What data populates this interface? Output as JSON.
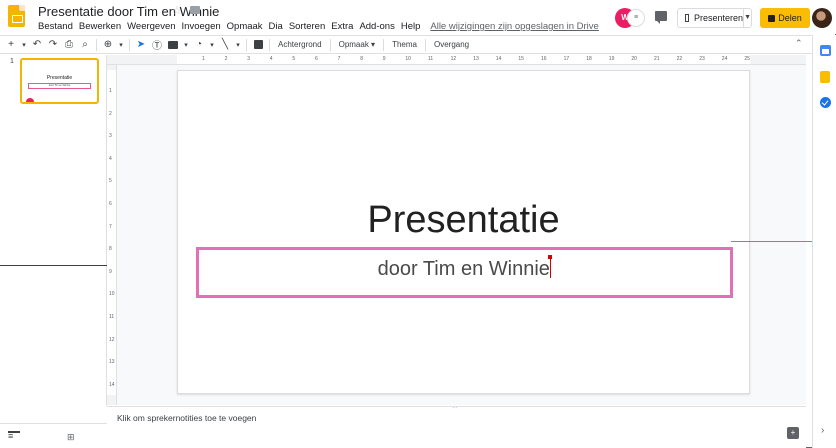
{
  "header": {
    "doc_title": "Presentatie door Tim en Winnie",
    "menu": [
      "Bestand",
      "Bewerken",
      "Weergeven",
      "Invoegen",
      "Opmaak",
      "Dia",
      "Sorteren",
      "Extra",
      "Add-ons",
      "Help"
    ],
    "save_status": "Alle wijzigingen zijn opgeslagen in Drive",
    "collaborator_initials": "W",
    "present_label": "Presenteren",
    "share_label": "Delen"
  },
  "toolbar": {
    "background_label": "Achtergrond",
    "layout_label": "Opmaak ▾",
    "theme_label": "Thema",
    "transition_label": "Overgang"
  },
  "filmstrip": {
    "slide_number": "1",
    "thumb_title": "Presentatie",
    "thumb_subtitle": "door Tim en Winnie"
  },
  "rulers": {
    "top": [
      "1",
      "2",
      "3",
      "4",
      "5",
      "6",
      "7",
      "8",
      "9",
      "10",
      "11",
      "12",
      "13",
      "14",
      "15",
      "16",
      "17",
      "18",
      "19",
      "20",
      "21",
      "22",
      "23",
      "24",
      "25"
    ],
    "left": [
      "1",
      "2",
      "3",
      "4",
      "5",
      "6",
      "7",
      "8",
      "9",
      "10",
      "11",
      "12",
      "13",
      "14"
    ]
  },
  "slide": {
    "title": "Presentatie",
    "subtitle": "door Tim en Winnie"
  },
  "notes": {
    "placeholder": "Klik om sprekernotities toe te voegen"
  },
  "colors": {
    "accent": "#f4b400",
    "subtitle_border": "#e36fb5",
    "share_button": "#fbbc04",
    "cursor": "#d50000"
  }
}
